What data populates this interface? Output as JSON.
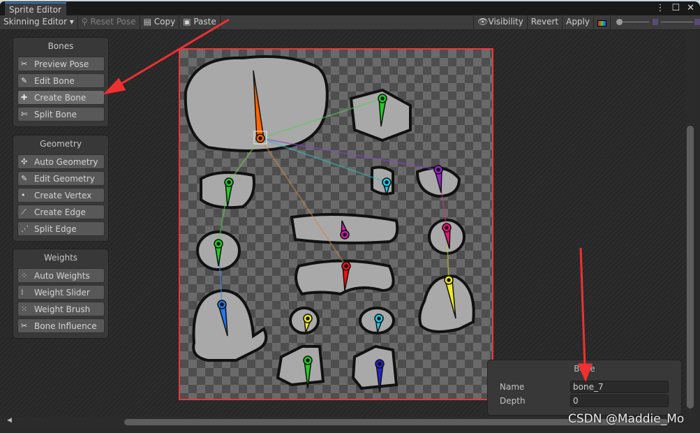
{
  "window": {
    "tab": "Sprite Editor",
    "menu_icon": "kebab-icon",
    "maximize_icon": "maximize-icon",
    "close_icon": "close-icon"
  },
  "toolbar": {
    "mode": "Skinning Editor ▾",
    "reset_pose": "Reset Pose",
    "copy": "Copy",
    "paste": "Paste",
    "visibility": "Visibility",
    "revert": "Revert",
    "apply": "Apply"
  },
  "panels": {
    "bones": {
      "title": "Bones",
      "items": [
        "Preview Pose",
        "Edit Bone",
        "Create Bone",
        "Split Bone"
      ],
      "selected": "Create Bone"
    },
    "geometry": {
      "title": "Geometry",
      "items": [
        "Auto Geometry",
        "Edit Geometry",
        "Create Vertex",
        "Create Edge",
        "Split Edge"
      ]
    },
    "weights": {
      "title": "Weights",
      "items": [
        "Auto Weights",
        "Weight Slider",
        "Weight Brush",
        "Bone Influence"
      ]
    }
  },
  "bone_inspector": {
    "title": "Bone",
    "name_label": "Name",
    "name_value": "bone_7",
    "depth_label": "Depth",
    "depth_value": "0"
  },
  "watermark": "CSDN @Maddie_Mo",
  "colors": {
    "selection_border": "#e8383c",
    "accent_tab": "#3a79bb",
    "annotation_arrow": "#f03030"
  }
}
